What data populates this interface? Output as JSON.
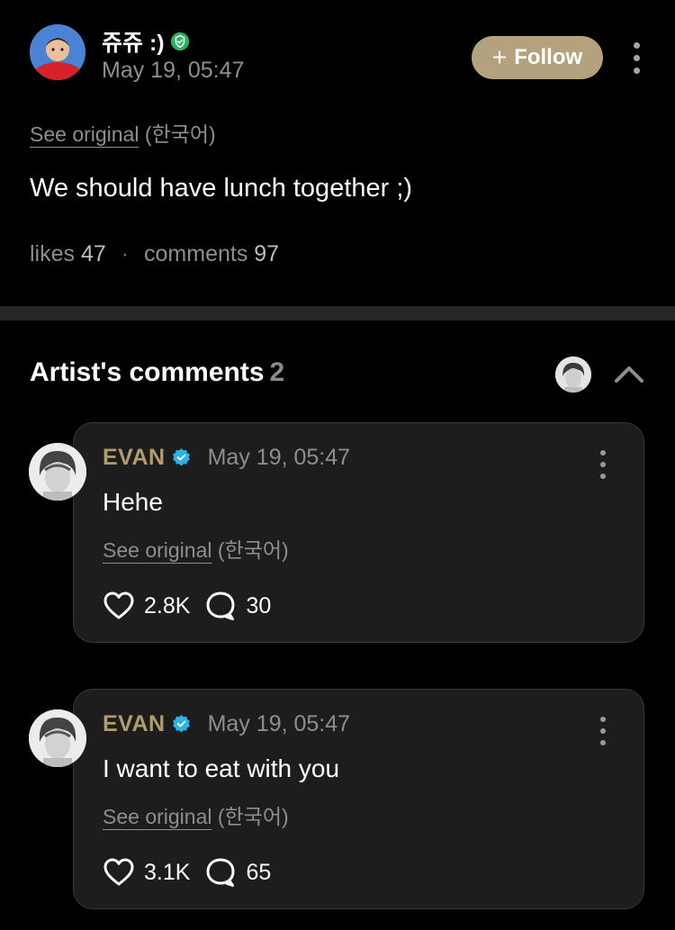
{
  "post": {
    "author": "쥬쥬 :)",
    "date": "May 19, 05:47",
    "follow_label": "Follow",
    "see_original": "See original",
    "original_lang": "(한국어)",
    "body": "We should have lunch together ;)",
    "likes_label": "likes",
    "likes_count": "47",
    "comments_label": "comments",
    "comments_count": "97"
  },
  "artist_comments": {
    "title": "Artist's comments",
    "count": "2",
    "items": [
      {
        "name": "EVAN",
        "date": "May 19, 05:47",
        "body": "Hehe",
        "see_original": "See original",
        "original_lang": "(한국어)",
        "likes": "2.8K",
        "replies": "30"
      },
      {
        "name": "EVAN",
        "date": "May 19, 05:47",
        "body": "I want to eat with you",
        "see_original": "See original",
        "original_lang": "(한국어)",
        "likes": "3.1K",
        "replies": "65"
      }
    ]
  },
  "icons": {
    "author_badge": "verified-green-icon",
    "artist_badge": "verified-blue-icon",
    "like": "heart-icon",
    "reply": "speech-bubble-icon",
    "menu": "more-vertical-icon",
    "collapse": "chevron-up-icon"
  },
  "colors": {
    "background": "#000000",
    "card": "#1d1d1d",
    "follow_button": "#b4a27e",
    "artist_name": "#b19c6e",
    "verified_blue": "#2bb3e3",
    "verified_green": "#29b363"
  }
}
